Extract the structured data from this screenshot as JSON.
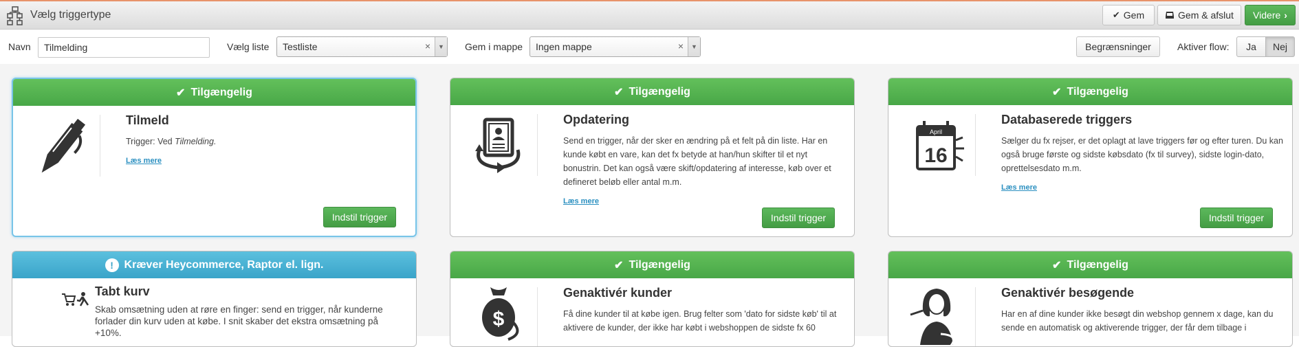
{
  "header": {
    "title": "Vælg triggertype",
    "icon": "sitemap-icon",
    "buttons": {
      "save_label": "Gem",
      "save_close_label": "Gem & afslut",
      "next_label": "Videre"
    }
  },
  "filters": {
    "name_label": "Navn",
    "name_value": "Tilmelding",
    "list_label": "Vælg liste",
    "list_value": "Testliste",
    "folder_label": "Gem i mappe",
    "folder_value": "Ingen mappe",
    "clear_glyph": "×",
    "restrictions_label": "Begrænsninger",
    "activate_label": "Aktiver flow:",
    "yes_label": "Ja",
    "no_label": "Nej",
    "activate_selected": "Nej"
  },
  "cards": [
    {
      "status": "Tilgængelig",
      "title": "Tilmeld",
      "desc_prefix": "Trigger: Ved ",
      "desc_italic": "Tilmelding.",
      "link": "Læs mere",
      "button": "Indstil trigger",
      "icon": "pen-icon"
    },
    {
      "status": "Tilgængelig",
      "title": "Opdatering",
      "desc": "Send en trigger, når der sker en ændring på et felt på din liste. Har en kunde købt en vare, kan det fx betyde at han/hun skifter til et nyt bonustrin. Det kan også være skift/opdatering af interesse, køb over et defineret beløb eller antal m.m.",
      "link": "Læs mere",
      "button": "Indstil trigger",
      "icon": "refresh-document-icon"
    },
    {
      "status": "Tilgængelig",
      "title": "Databaserede triggers",
      "desc": "Sælger du fx rejser, er det oplagt at lave triggers før og efter turen. Du kan også bruge første og sidste købsdato (fx til survey), sidste login-dato, oprettelsesdato m.m.",
      "link": "Læs mere",
      "button": "Indstil trigger",
      "icon": "calendar-icon",
      "calendar_month": "April",
      "calendar_day": "16"
    },
    {
      "status": "Kræver Heycommerce, Raptor el. lign.",
      "title": "Tabt kurv",
      "desc": "Skab omsætning uden at røre en finger: send en trigger, når kunderne forlader din kurv uden at købe. I snit skaber det ekstra omsætning på +10%.",
      "icon": "abandoned-cart-icon"
    },
    {
      "status": "Tilgængelig",
      "title": "Genaktivér kunder",
      "desc": "Få dine kunder til at købe igen. Brug felter som 'dato for sidste køb' til at aktivere de kunder, der ikke har købt i webshoppen de sidste fx 60",
      "icon": "money-bag-icon",
      "money_symbol": "$"
    },
    {
      "status": "Tilgængelig",
      "title": "Genaktivér besøgende",
      "desc": "Har en af dine kunder ikke besøgt din webshop gennem x dage, kan du sende en automatisk og aktiverende trigger, der får dem tilbage i",
      "icon": "woman-return-icon"
    }
  ],
  "colors": {
    "available_green": "#5cb85c",
    "requires_blue": "#5bc0de",
    "link_blue": "#2a8fc0",
    "top_accent": "#e8936a"
  }
}
